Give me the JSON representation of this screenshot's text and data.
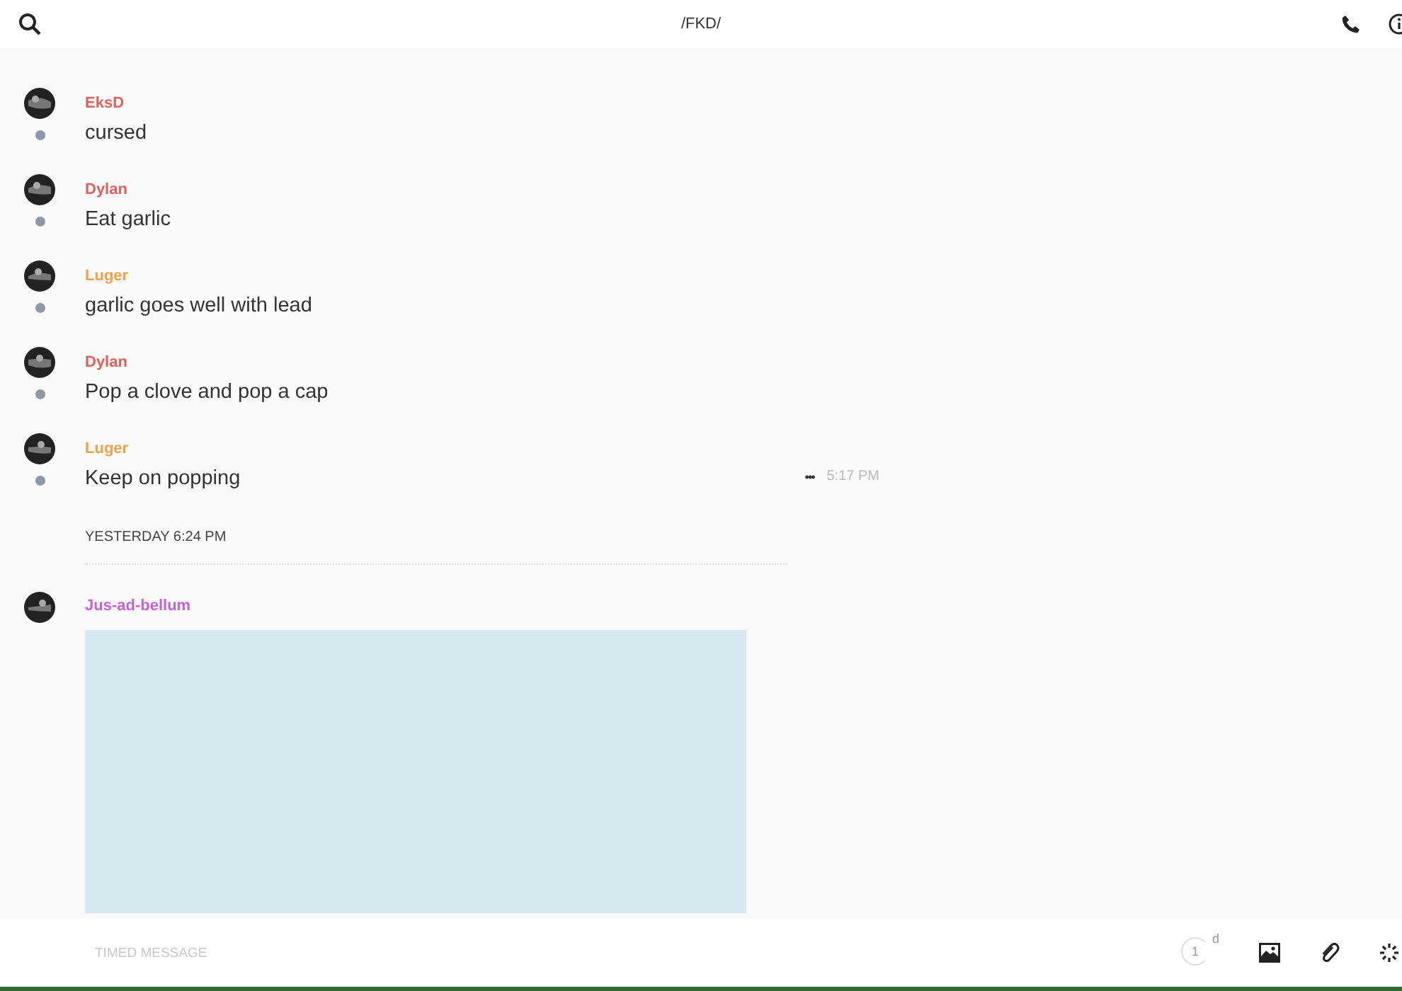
{
  "header": {
    "title": "/FKD/"
  },
  "messages": [
    {
      "author": "EksD",
      "color": "#e0605e",
      "text": "cursed"
    },
    {
      "author": "Dylan",
      "color": "#e0605e",
      "text": "Eat garlic"
    },
    {
      "author": "Luger",
      "color": "#f2a14a",
      "text": "garlic goes well with lead"
    },
    {
      "author": "Dylan",
      "color": "#e0605e",
      "text": "Pop a clove and pop a cap"
    },
    {
      "author": "Luger",
      "color": "#f2a14a",
      "text": "Keep on popping",
      "more": "•••",
      "time": "5:17 PM"
    }
  ],
  "divider": {
    "label": "YESTERDAY 6:24 PM"
  },
  "attachment_message": {
    "author": "Jus-ad-bellum",
    "color": "#c462d6",
    "kind": "image"
  },
  "composer": {
    "placeholder": "TIMED MESSAGE",
    "timer": "1",
    "timer_unit": "d"
  }
}
